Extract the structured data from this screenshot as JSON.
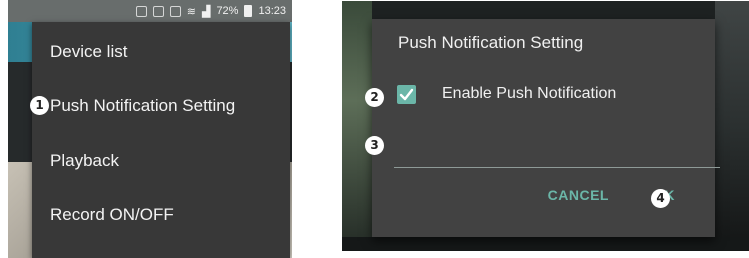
{
  "left_screen": {
    "status_bar": {
      "battery": "72%",
      "time": "13:23",
      "icons": [
        "nfc-icon",
        "mute-icon",
        "alarm-icon",
        "wifi-icon",
        "signal-icon",
        "battery-icon"
      ]
    },
    "menu": {
      "items": [
        {
          "label": "Device list"
        },
        {
          "label": "Push Notification Setting"
        },
        {
          "label": "Playback"
        },
        {
          "label": "Record ON/OFF"
        }
      ]
    }
  },
  "right_screen": {
    "dialog": {
      "title": "Push Notification Setting",
      "checkbox_label": "Enable Push Notification",
      "checkbox_checked": true,
      "input_value": "",
      "cancel_label": "CANCEL",
      "ok_label": "OK"
    }
  },
  "markers": [
    "1",
    "2",
    "3",
    "4"
  ],
  "colors": {
    "menu_bg": "#383838",
    "dialog_bg": "#424242",
    "accent": "#6bb6a8",
    "text": "#f0f0f0"
  }
}
